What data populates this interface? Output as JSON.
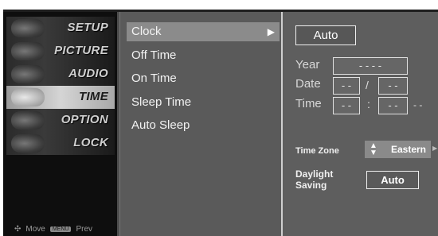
{
  "left_menu": {
    "items": [
      {
        "label": "SETUP",
        "active": false
      },
      {
        "label": "PICTURE",
        "active": false
      },
      {
        "label": "AUDIO",
        "active": false
      },
      {
        "label": "TIME",
        "active": true
      },
      {
        "label": "OPTION",
        "active": false
      },
      {
        "label": "LOCK",
        "active": false
      }
    ],
    "footer": {
      "move_label": "Move",
      "prev_key": "MENU",
      "prev_label": "Prev"
    }
  },
  "sub_menu": {
    "items": [
      {
        "label": "Clock",
        "selected": true
      },
      {
        "label": "Off Time",
        "selected": false
      },
      {
        "label": "On Time",
        "selected": false
      },
      {
        "label": "Sleep Time",
        "selected": false
      },
      {
        "label": "Auto Sleep",
        "selected": false
      }
    ],
    "arrow": "▶"
  },
  "clock_panel": {
    "mode": "Auto",
    "year_label": "Year",
    "year_value": "- - - -",
    "date_label": "Date",
    "date_month": "- -",
    "date_sep": "/",
    "date_day": "- -",
    "time_label": "Time",
    "time_hour": "- -",
    "time_sep": ":",
    "time_min": "- -",
    "time_ampm": "- -",
    "time_zone_label": "Time Zone",
    "time_zone_value": "Eastern",
    "daylight_label_1": "Daylight",
    "daylight_label_2": "Saving",
    "daylight_value": "Auto"
  }
}
